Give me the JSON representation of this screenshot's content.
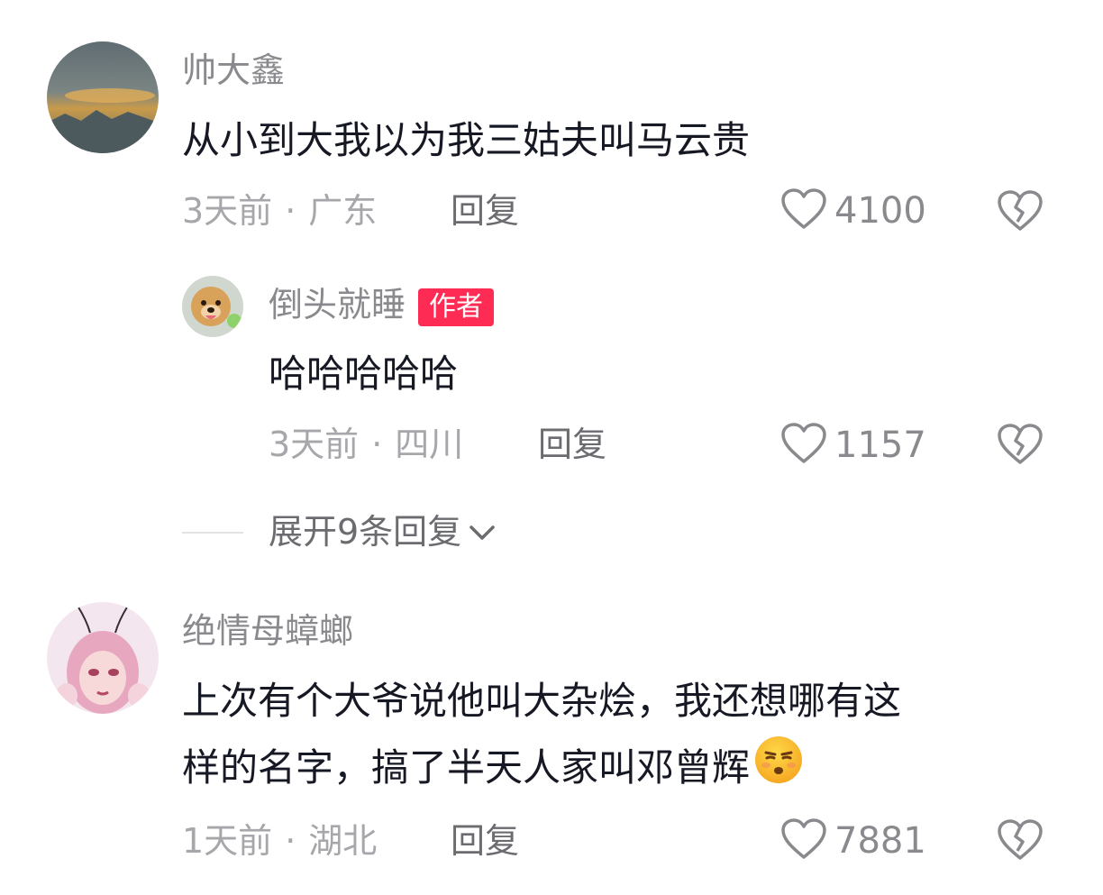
{
  "comments": [
    {
      "username": "帅大鑫",
      "text": "从小到大我以为我三姑夫叫马云贵",
      "time": "3天前",
      "location": "广东",
      "reply_label": "回复",
      "likes": "4100",
      "reply": {
        "username": "倒头就睡",
        "badge": "作者",
        "text": "哈哈哈哈哈",
        "time": "3天前",
        "location": "四川",
        "reply_label": "回复",
        "likes": "1157"
      },
      "expand_label": "展开9条回复"
    },
    {
      "username": "绝情母蟑螂",
      "text_line1": "上次有个大爷说他叫大杂烩，我还想哪有这",
      "text_line2": "样的名字，搞了半天人家叫邓曾辉",
      "emoji": "smirk-face-emoji",
      "time": "1天前",
      "location": "湖北",
      "reply_label": "回复",
      "likes": "7881"
    }
  ],
  "icons": {
    "like": "heart-outline-icon",
    "dislike": "broken-heart-icon",
    "expand": "chevron-down-icon"
  },
  "colors": {
    "badge": "#fe2c55",
    "meta": "#a7a7ab",
    "name": "#8a8a8e"
  }
}
